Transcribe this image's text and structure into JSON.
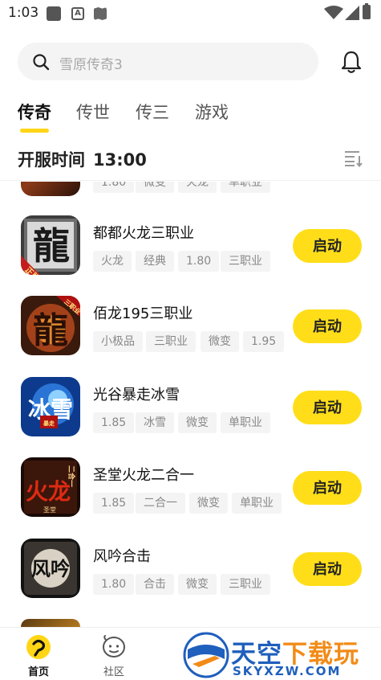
{
  "status_bar": {
    "time": "1:03",
    "app_icon_letter": "A"
  },
  "search": {
    "placeholder": "雪原传奇3"
  },
  "tabs": [
    {
      "label": "传奇",
      "active": true
    },
    {
      "label": "传世",
      "active": false
    },
    {
      "label": "传三",
      "active": false
    },
    {
      "label": "游戏",
      "active": false
    }
  ],
  "server": {
    "label": "开服时间",
    "time": "13:00"
  },
  "partial_item": {
    "tags": [
      "1.80",
      "微变",
      "火龙",
      "单职业"
    ]
  },
  "games": [
    {
      "name": "都都火龙三职业",
      "tags": [
        "火龙",
        "经典",
        "1.80",
        "三职业"
      ],
      "icon_char": "龍",
      "icon_badge": "正版",
      "button": "启动"
    },
    {
      "name": "佰龙195三职业",
      "tags": [
        "小极品",
        "三职业",
        "微变",
        "1.95"
      ],
      "icon_char": "龍",
      "icon_badge": "三职业",
      "button": "启动"
    },
    {
      "name": "光谷暴走冰雪",
      "tags": [
        "1.85",
        "冰雪",
        "微变",
        "单职业"
      ],
      "icon_char": "冰雪",
      "icon_badge": "暴走",
      "button": "启动"
    },
    {
      "name": "圣堂火龙二合一",
      "tags": [
        "1.85",
        "二合一",
        "微变",
        "单职业"
      ],
      "icon_char": "火龙",
      "icon_badge": "二合一",
      "icon_sub": "圣堂",
      "button": "启动"
    },
    {
      "name": "风吟合击",
      "tags": [
        "1.80",
        "合击",
        "微变",
        "三职业"
      ],
      "icon_char": "风吟",
      "button": "启动"
    }
  ],
  "tabbar": [
    {
      "label": "首页",
      "active": true
    },
    {
      "label": "社区",
      "active": false
    }
  ],
  "watermark": {
    "title_blue": "天空",
    "title_orange": "下载玩",
    "subtitle": "SKYXZW.COM"
  },
  "colors": {
    "accent": "#ffde19",
    "tag_bg": "#f4f4f4",
    "tag_text": "#888888",
    "watermark_blue": "#1f5fbd",
    "watermark_orange": "#f28b18"
  }
}
